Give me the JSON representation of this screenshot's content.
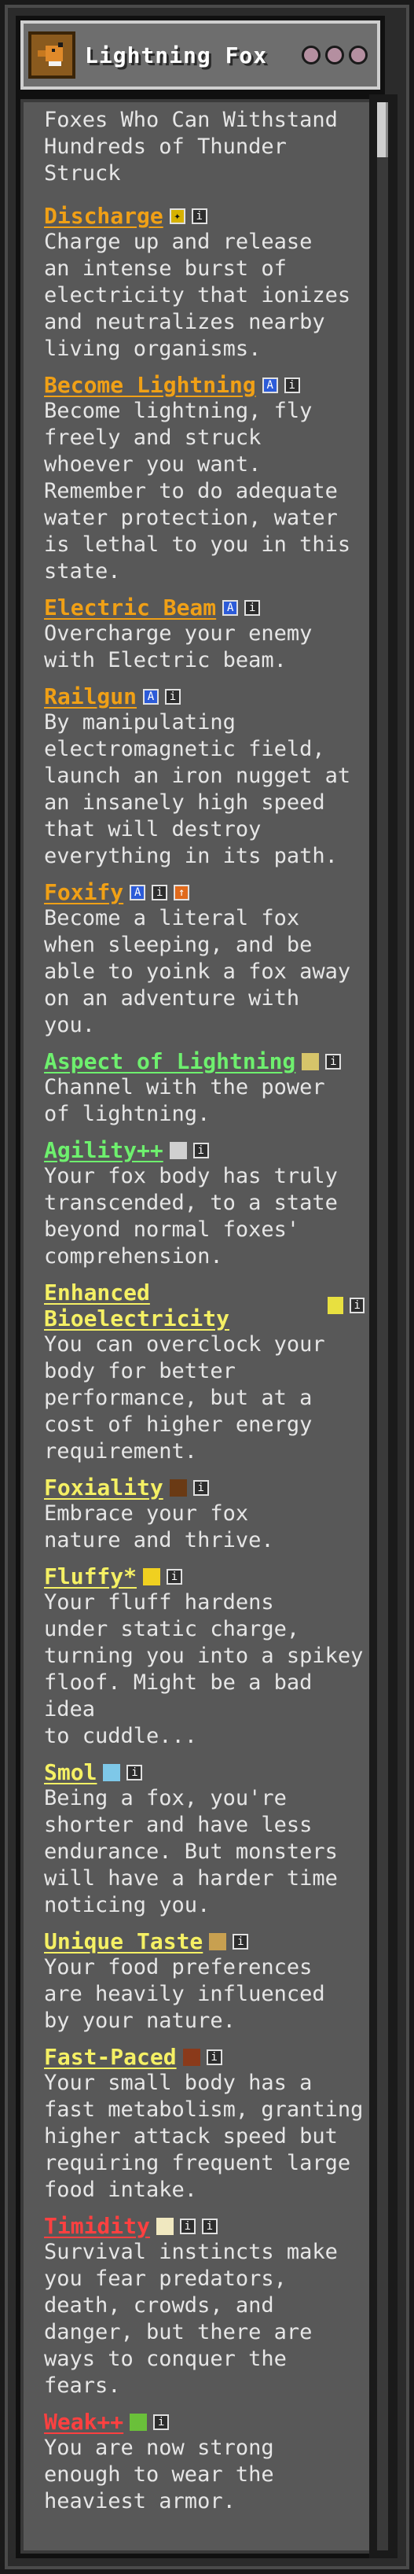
{
  "window": {
    "title": "Lightning Fox",
    "origin_icon": "fox-emblem-icon",
    "impact_indicators": 3
  },
  "subtitle": "Foxes Who Can Withstand\nHundreds of Thunder\nStruck",
  "powers": [
    {
      "name": "Discharge",
      "color": "#f0a016",
      "badges": [
        "gold",
        "info"
      ],
      "desc": "Charge up and release\nan intense burst of\nelectricity that ionizes\nand neutralizes nearby\nliving organisms."
    },
    {
      "name": "Become Lightning",
      "color": "#f0a016",
      "badges": [
        "blue",
        "info"
      ],
      "desc": "Become lightning, fly\nfreely and struck\nwhoever you want.\nRemember to do adequate\nwater protection, water\nis lethal to you in this\nstate."
    },
    {
      "name": "Electric Beam",
      "color": "#f0a016",
      "badges": [
        "blue",
        "info"
      ],
      "desc": "Overcharge your enemy\nwith Electric beam."
    },
    {
      "name": "Railgun",
      "color": "#f0a016",
      "badges": [
        "blue",
        "info"
      ],
      "desc": "By manipulating\nelectromagnetic field,\nlaunch an iron nugget at\nan insanely high speed\nthat will destroy\neverything in its path."
    },
    {
      "name": "Foxify",
      "color": "#f0a016",
      "badges": [
        "blue",
        "info",
        "orange"
      ],
      "desc": "Become a literal fox\nwhen sleeping, and be\nable to yoink a fox away\non an adventure with\nyou."
    },
    {
      "name": "Aspect of Lightning",
      "color": "#6ef06e",
      "badges": [
        "wand",
        "info"
      ],
      "desc": "Channel with the power\nof lightning."
    },
    {
      "name": "Agility++",
      "color": "#6ef06e",
      "badges": [
        "feather",
        "info"
      ],
      "desc": "Your fox body has truly\ntranscended, to a state\nbeyond normal foxes'\ncomprehension."
    },
    {
      "name": "Enhanced Bioelectricity",
      "color": "#f5f064",
      "badges": [
        "battery",
        "info"
      ],
      "desc": "You can overclock your\nbody for better\nperformance, but at a\ncost of higher energy\nrequirement."
    },
    {
      "name": "Foxiality",
      "color": "#f5f064",
      "badges": [
        "brown",
        "info"
      ],
      "desc": "Embrace your fox\nnature and thrive."
    },
    {
      "name": "Fluffy*",
      "color": "#f5f064",
      "badges": [
        "yellow",
        "info"
      ],
      "desc": "Your fluff hardens\nunder static charge,\nturning you into a spikey\nfloof. Might be a bad idea\nto cuddle..."
    },
    {
      "name": "Smol",
      "color": "#f5f064",
      "badges": [
        "drop",
        "info"
      ],
      "desc": "Being a fox, you're\nshorter and have less\nendurance. But monsters\nwill have a harder time\nnoticing you."
    },
    {
      "name": "Unique Taste",
      "color": "#f5f064",
      "badges": [
        "food",
        "info"
      ],
      "desc": "Your food preferences\nare heavily influenced\nby your nature."
    },
    {
      "name": "Fast-Paced",
      "color": "#f5f064",
      "badges": [
        "meat",
        "info"
      ],
      "desc": "Your small body has a\nfast metabolism, granting\nhigher attack speed but\nrequiring frequent large\nfood intake."
    },
    {
      "name": "Timidity",
      "color": "#ff4040",
      "badges": [
        "egg",
        "info",
        "info"
      ],
      "desc": "Survival instincts make\nyou fear predators,\ndeath, crowds, and\ndanger, but there are\nways to conquer the\nfears."
    },
    {
      "name": "Weak++",
      "color": "#ff4040",
      "badges": [
        "leaf",
        "info"
      ],
      "desc": "You are now strong\nenough to wear the\nheaviest armor."
    }
  ]
}
